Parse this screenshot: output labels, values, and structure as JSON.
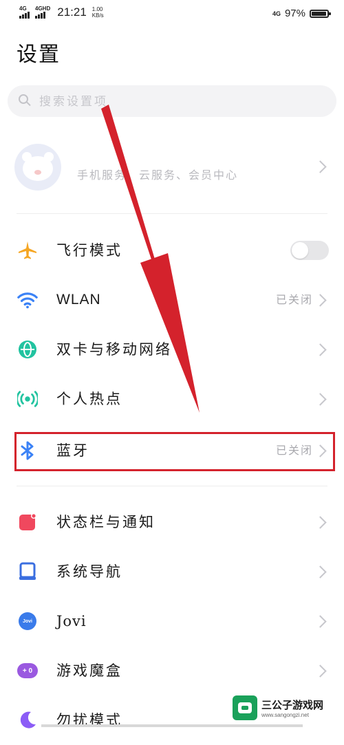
{
  "status_bar": {
    "sim1_label": "4G",
    "sim2_label": "4GHD",
    "time": "21:21",
    "speed_value": "1.00",
    "speed_unit": "KB/s",
    "network_label": "4G",
    "battery_pct": "97%",
    "battery_level": 0.97
  },
  "page": {
    "title": "设置"
  },
  "search": {
    "placeholder": "搜索设置项"
  },
  "account": {
    "text": "手机服务、云服务、会员中心"
  },
  "rows": [
    {
      "label": "飞行模式",
      "value": "",
      "icon": "airplane-icon",
      "toggle": false,
      "color": "#f5a623"
    },
    {
      "label": "WLAN",
      "value": "已关闭",
      "icon": "wifi-icon",
      "color": "#3b82f6"
    },
    {
      "label": "双卡与移动网络",
      "value": "",
      "icon": "globe-icon",
      "color": "#22c3a0"
    },
    {
      "label": "个人热点",
      "value": "",
      "icon": "hotspot-icon",
      "color": "#22c3a0"
    },
    {
      "label": "蓝牙",
      "value": "已关闭",
      "icon": "bluetooth-icon",
      "color": "#3b82f6"
    },
    {
      "label": "状态栏与通知",
      "value": "",
      "icon": "notification-icon",
      "color": "#f0485e"
    },
    {
      "label": "系统导航",
      "value": "",
      "icon": "navigation-icon",
      "color": "#3b6fe0"
    },
    {
      "label": "Jovi",
      "value": "",
      "icon": "jovi-icon",
      "badge": "Jovi",
      "color": "#3a7bea"
    },
    {
      "label": "游戏魔盒",
      "value": "",
      "icon": "game-box-icon",
      "badge": "+ 0",
      "color": "#9a59e0"
    },
    {
      "label": "勿扰模式",
      "value": "",
      "icon": "moon-icon",
      "color": "#8b5cf6"
    }
  ],
  "annotation": {
    "highlight_color": "#d4222c"
  },
  "watermark": {
    "name": "三公子游戏网",
    "url": "www.sangongzi.net"
  }
}
